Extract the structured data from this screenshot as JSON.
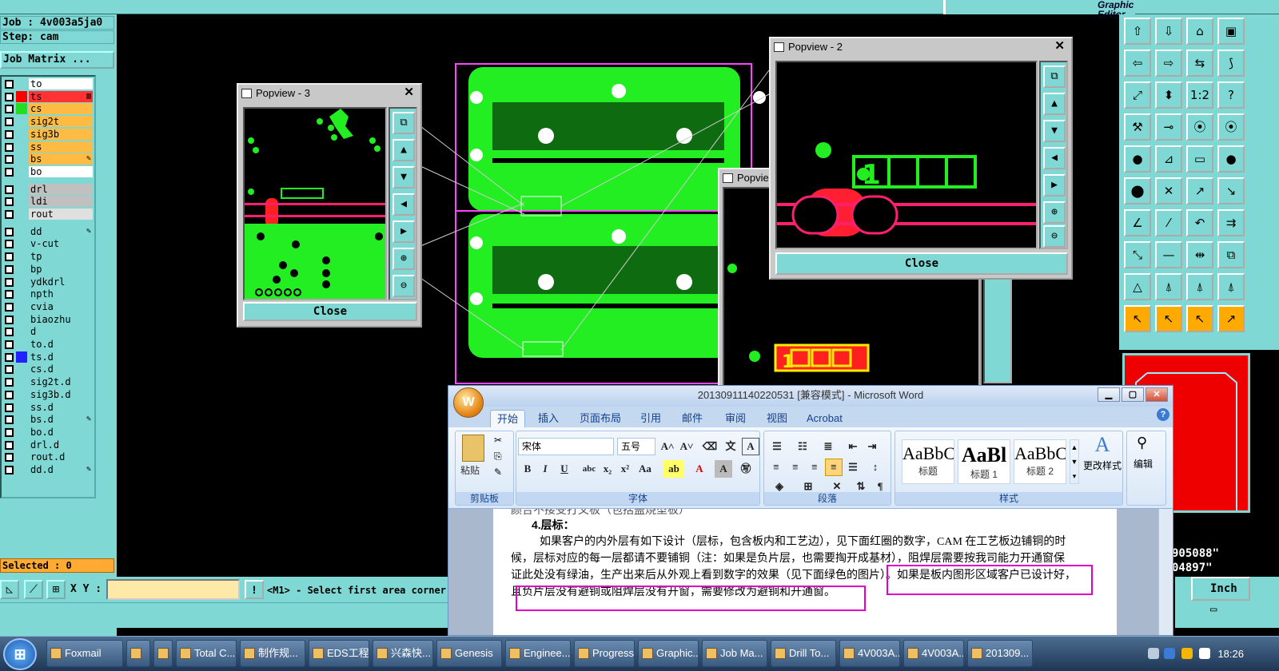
{
  "genesis": {
    "title_fragment": "Graphic Editor",
    "job_line": "Job : 4v003a5ja0",
    "step_line": "Step: cam",
    "matrix_button": "Job Matrix ...",
    "layers": [
      {
        "name": "to",
        "color": "#ffffff",
        "swatch": ""
      },
      {
        "name": "ts",
        "color": "#ff3333",
        "swatch": "#ff0000",
        "mark": "▥"
      },
      {
        "name": "cs",
        "color": "#ffbb44",
        "swatch": "#22dd22"
      },
      {
        "name": "sig2t",
        "color": "#ffbb44",
        "swatch": ""
      },
      {
        "name": "sig3b",
        "color": "#ffbb44",
        "swatch": ""
      },
      {
        "name": "ss",
        "color": "#ffbb44",
        "swatch": ""
      },
      {
        "name": "bs",
        "color": "#ffbb44",
        "swatch": "",
        "mark": "✎"
      },
      {
        "name": "bo",
        "color": "#ffffff",
        "swatch": ""
      },
      {
        "name": "drl",
        "color": "#c0c0c0",
        "swatch": ""
      },
      {
        "name": "ldi",
        "color": "#c0c0c0",
        "swatch": ""
      },
      {
        "name": "rout",
        "color": "#e0e0e0",
        "swatch": ""
      },
      {
        "name": "dd",
        "color": "#7fd8d4",
        "swatch": "",
        "mark": "✎"
      },
      {
        "name": "v-cut",
        "color": "#7fd8d4",
        "swatch": ""
      },
      {
        "name": "tp",
        "color": "#7fd8d4",
        "swatch": ""
      },
      {
        "name": "bp",
        "color": "#7fd8d4",
        "swatch": ""
      },
      {
        "name": "ydkdrl",
        "color": "#7fd8d4",
        "swatch": ""
      },
      {
        "name": "npth",
        "color": "#7fd8d4",
        "swatch": ""
      },
      {
        "name": "cvia",
        "color": "#7fd8d4",
        "swatch": ""
      },
      {
        "name": "biaozhu",
        "color": "#7fd8d4",
        "swatch": ""
      },
      {
        "name": "d",
        "color": "#7fd8d4",
        "swatch": ""
      },
      {
        "name": "to.d",
        "color": "#7fd8d4",
        "swatch": ""
      },
      {
        "name": "ts.d",
        "color": "#7fd8d4",
        "swatch": "#2222ff"
      },
      {
        "name": "cs.d",
        "color": "#7fd8d4",
        "swatch": ""
      },
      {
        "name": "sig2t.d",
        "color": "#7fd8d4",
        "swatch": ""
      },
      {
        "name": "sig3b.d",
        "color": "#7fd8d4",
        "swatch": ""
      },
      {
        "name": "ss.d",
        "color": "#7fd8d4",
        "swatch": ""
      },
      {
        "name": "bs.d",
        "color": "#7fd8d4",
        "swatch": "",
        "mark": "✎"
      },
      {
        "name": "bo.d",
        "color": "#7fd8d4",
        "swatch": ""
      },
      {
        "name": "drl.d",
        "color": "#7fd8d4",
        "swatch": ""
      },
      {
        "name": "rout.d",
        "color": "#7fd8d4",
        "swatch": ""
      },
      {
        "name": "dd.d",
        "color": "#7fd8d4",
        "swatch": "",
        "mark": "✎"
      }
    ],
    "selected": "Selected : 0",
    "xy_label": "X Y :",
    "prompt": "<M1> - Select first area corner",
    "coords": [
      "905088\"",
      "04897\""
    ],
    "units": "Inch"
  },
  "popviews": {
    "p3": {
      "title": "Popview - 3",
      "close": "Close"
    },
    "p2": {
      "title": "Popview - 2",
      "close": "Close"
    },
    "p1": {
      "title": "Popvie"
    }
  },
  "word": {
    "title": "20130911140220531 [兼容模式] - Microsoft Word",
    "office_glyph": "W",
    "tabs": [
      "开始",
      "插入",
      "页面布局",
      "引用",
      "邮件",
      "审阅",
      "视图",
      "Acrobat"
    ],
    "paste_label": "粘贴",
    "font_name": "宋体",
    "font_size": "五号",
    "groups": {
      "clipboard": "剪贴板",
      "font": "字体",
      "paragraph": "段落",
      "styles": "样式",
      "edit": "编辑"
    },
    "styles": [
      {
        "preview": "AaBbC",
        "label": "标题"
      },
      {
        "preview": "AaBl",
        "label": "标题 1"
      },
      {
        "preview": "AaBbC",
        "label": "标题 2"
      }
    ],
    "change_styles": "更改样式",
    "doc_top_fragment": "颜合不接受打叉板（包括盖烧型板）",
    "doc_heading": "4.层标：",
    "doc_lines": [
      "如果客户的内外层有如下设计（层标，包含板内和工艺边），见下面红圈的数字，CAM 在工艺板边铺铜的时",
      "候，层标对应的每一层都请不要铺铜（注：如果是负片层，也需要掏开成基材），阻焊层需要按我司能力开通窗保",
      "证此处没有绿油，生产出来后从外观上看到数字的效果（见下面绿色的图片）。如果是板内图形区域客户已设计好，",
      "且负片层没有避铜或阻焊层没有开窗，需要修改为避铜和开通窗。"
    ]
  },
  "taskbar": {
    "items": [
      "Foxmail",
      "",
      "",
      "Total C...",
      "制作规...",
      "EDS工程...",
      "兴森快...",
      "Genesis",
      "Enginee...",
      "Progress",
      "Graphic...",
      "Job Ma...",
      "Drill To...",
      "4V003A...",
      "4V003A...",
      "201309..."
    ],
    "clock": "18:26"
  }
}
